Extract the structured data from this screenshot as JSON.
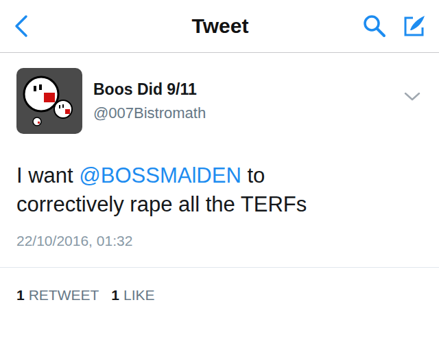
{
  "header": {
    "title": "Tweet"
  },
  "tweet": {
    "author_name": "Boos Did 9/11",
    "handle": "@007Bistromath",
    "text_parts": [
      {
        "text": "I want ",
        "mention": false
      },
      {
        "text": "@BOSSMAlDEN",
        "mention": true
      },
      {
        "text": " to correctively rape all the TERFs",
        "mention": false
      }
    ],
    "timestamp": "22/10/2016, 01:32"
  },
  "stats": [
    {
      "count": "1",
      "label": "RETWEET"
    },
    {
      "count": "1",
      "label": "LIKE"
    }
  ]
}
